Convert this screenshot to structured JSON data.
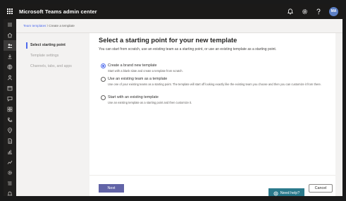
{
  "app": {
    "title": "Microsoft Teams admin center",
    "avatar_initials": "MA"
  },
  "topbar": {
    "icons": [
      "bell-icon",
      "gear-icon",
      "help-icon"
    ]
  },
  "leftrail": {
    "icons": [
      "menu-icon",
      "home-icon",
      "teams-icon",
      "download-icon",
      "globe-icon",
      "people-icon",
      "meetings-icon",
      "messaging-icon",
      "apps-icon",
      "voice-icon",
      "locations-icon",
      "policy-icon",
      "analytics-icon",
      "reports-icon",
      "settings-icon",
      "planning-icon",
      "notifications-icon"
    ]
  },
  "breadcrumb": {
    "parent": "Team templates",
    "separator": "\\",
    "current": "Create a template"
  },
  "steps": [
    {
      "label": "Select starting point",
      "active": true
    },
    {
      "label": "Template settings",
      "active": false
    },
    {
      "label": "Channels, tabs, and apps",
      "active": false
    }
  ],
  "main": {
    "title": "Select a starting point for your new template",
    "subtitle": "You can start from scratch, use an existing team as a starting point, or use an existing template as a starting point.",
    "options": [
      {
        "label": "Create a brand new template",
        "description": "Start with a blank slate and create a template from scratch.",
        "checked": true
      },
      {
        "label": "Use an existing team as a template",
        "description": "Use one of your existing teams as a starting point. The template will start off looking exactly like the existing team you choose and then you can customize it from there.",
        "checked": false
      },
      {
        "label": "Start with an existing template",
        "description": "Use an existing template as a starting point and then customize it.",
        "checked": false
      }
    ]
  },
  "footer": {
    "next_label": "Next",
    "cancel_label": "Cancel"
  },
  "help": {
    "label": "Need help?"
  },
  "colors": {
    "topbar": "#1b1a19",
    "rail": "#201f1e",
    "accent": "#4f6bed",
    "primary_button": "#6264a7",
    "help_button": "#2b7a8c"
  }
}
